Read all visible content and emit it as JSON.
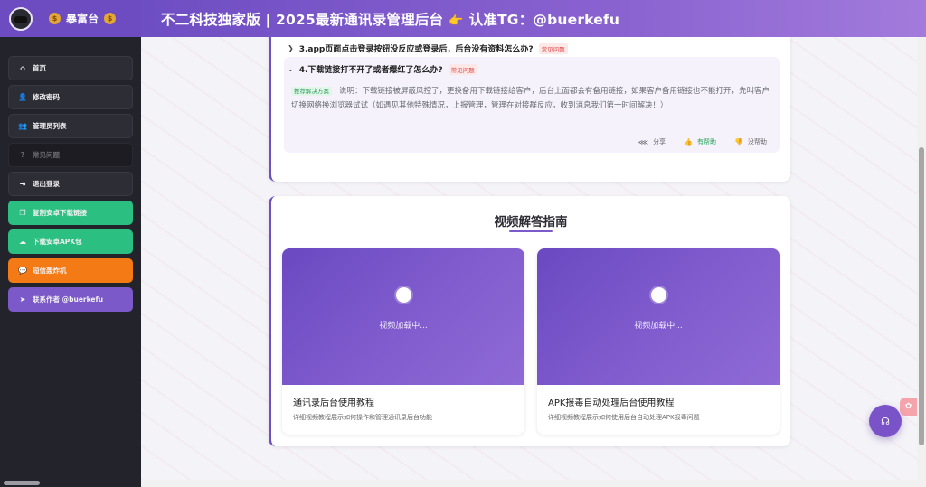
{
  "sidebar": {
    "brand": "暴富台",
    "bag_icon": "money-bag-icon",
    "items": [
      {
        "label": "首页",
        "icon": "home-icon",
        "glyph": "⌂"
      },
      {
        "label": "修改密码",
        "icon": "user-edit-icon",
        "glyph": "👤"
      },
      {
        "label": "管理员列表",
        "icon": "users-icon",
        "glyph": "👥"
      },
      {
        "label": "常见问题",
        "icon": "question-circle-icon",
        "glyph": "?"
      },
      {
        "label": "退出登录",
        "icon": "sign-out-icon",
        "glyph": "⇥"
      },
      {
        "label": "复制安卓下载链接",
        "icon": "copy-icon",
        "glyph": "❐"
      },
      {
        "label": "下载安卓APK包",
        "icon": "cloud-download-icon",
        "glyph": "☁"
      },
      {
        "label": "短信轰炸机",
        "icon": "chat-icon",
        "glyph": "💬"
      },
      {
        "label": "联系作者 @buerkefu",
        "icon": "telegram-icon",
        "glyph": "➤"
      }
    ]
  },
  "header": {
    "title_left": "不二科技独家版 | 2025最新通讯录管理后台",
    "hand_icon": "pointing-hand-icon",
    "title_right": "认准TG：@buerkefu"
  },
  "faq": {
    "q3": {
      "title": "3.app页面点击登录按钮没反应或登录后，后台没有资料怎么办?",
      "tag": "常见问题"
    },
    "q4": {
      "title": "4.下载链接打不开了或者爆红了怎么办?",
      "tag": "常见问题",
      "solution_tag": "推荐解决方案",
      "answer": "说明：下载链接被屏蔽风控了，更换备用下载链接给客户，后台上面都会有备用链接，如果客户备用链接也不能打开，先叫客户切换网络换浏览器试试（如遇见其他特殊情况，上报管理，管理在对接群反应，收到消息我们第一时间解决！）",
      "share": "分享",
      "helpful": "有帮助",
      "not_helpful": "没帮助"
    }
  },
  "video": {
    "title": "视频解答指南",
    "items": [
      {
        "loading": "视频加载中...",
        "name": "通讯录后台使用教程",
        "desc": "详细视频教程展示如何操作和管理通讯录后台功能"
      },
      {
        "loading": "视频加载中...",
        "name": "APK报毒自动处理后台使用教程",
        "desc": "详细视频教程展示如何使用后台自动处理APK报毒问题"
      }
    ]
  },
  "colors": {
    "accent": "#6f4fc4",
    "green": "#2bbf82",
    "orange": "#f47a15",
    "sidebar_bg": "#23232b"
  }
}
